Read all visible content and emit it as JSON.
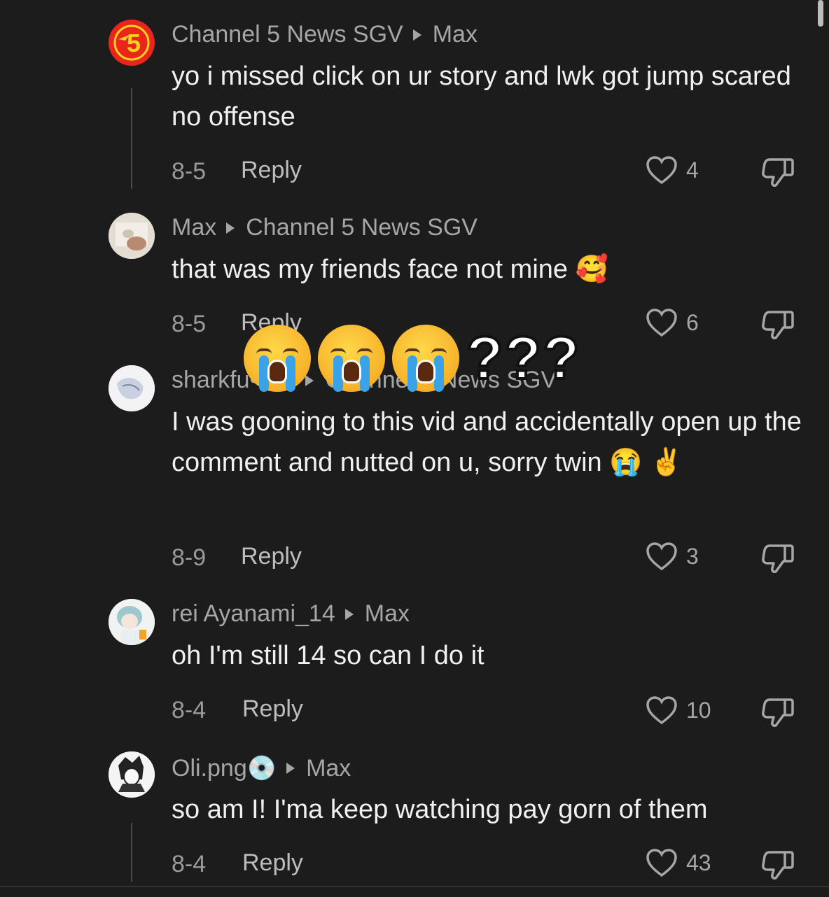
{
  "comments": [
    {
      "author": "Channel 5 News SGV",
      "reply_to": "Max",
      "text": "yo i missed click on ur story and lwk got jump scared no offense",
      "date": "8-5",
      "reply_label": "Reply",
      "likes": "4",
      "avatar_badge": "5"
    },
    {
      "author": "Max",
      "reply_to": "Channel 5 News SGV",
      "text": "that was my friends face not mine 🥰",
      "date": "8-5",
      "reply_label": "Reply",
      "likes": "6"
    },
    {
      "author": "sharkfu••r3•",
      "reply_to": "Channel 5 News SGV",
      "text": "I was gooning to this vid and accidentally open up the comment and nutted on u, sorry twin 😭 ✌️",
      "date": "8-9",
      "reply_label": "Reply",
      "likes": "3"
    },
    {
      "author": "rei Ayanami_14",
      "reply_to": "Max",
      "text": "oh I'm still 14 so can I do it",
      "date": "8-4",
      "reply_label": "Reply",
      "likes": "10"
    },
    {
      "author": "Oli.png💿",
      "reply_to": "Max",
      "text": "so am I! I'ma keep watching pay gorn of them",
      "date": "8-4",
      "reply_label": "Reply",
      "likes": "43"
    }
  ],
  "overlay": {
    "question_marks": "???"
  },
  "colors": {
    "background": "#1c1c1c",
    "badge_red": "#e8261c",
    "badge_yellow": "#ffd21f"
  }
}
